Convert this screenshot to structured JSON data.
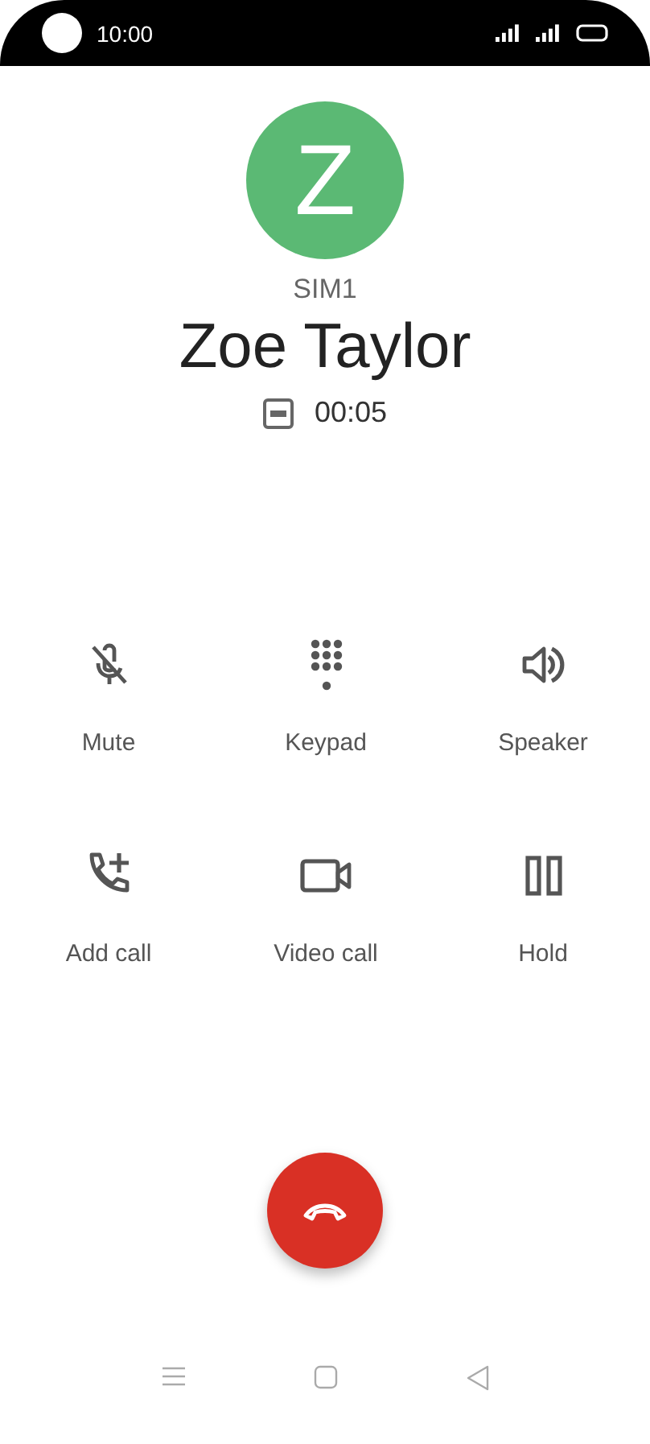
{
  "status_bar": {
    "time": "10:00"
  },
  "caller": {
    "initial": "Z",
    "sim": "SIM1",
    "name": "Zoe Taylor",
    "duration": "00:05"
  },
  "actions": [
    {
      "kind": "mute",
      "label": "Mute"
    },
    {
      "kind": "keypad",
      "label": "Keypad"
    },
    {
      "kind": "speaker",
      "label": "Speaker"
    },
    {
      "kind": "add_call",
      "label": "Add call"
    },
    {
      "kind": "video",
      "label": "Video call"
    },
    {
      "kind": "hold",
      "label": "Hold"
    }
  ]
}
